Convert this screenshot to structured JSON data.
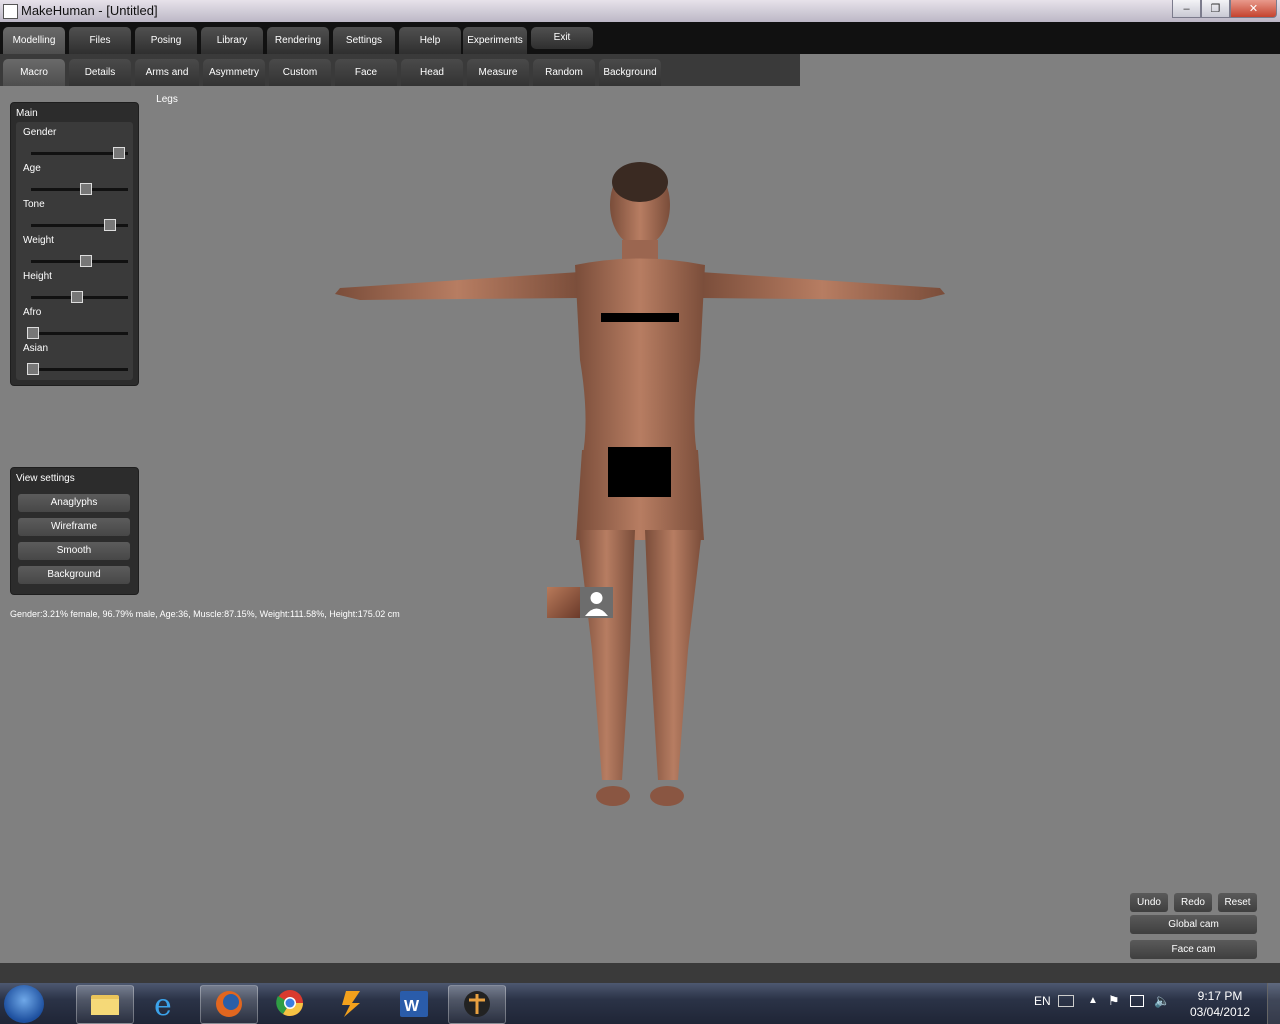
{
  "window": {
    "title": "MakeHuman - [Untitled]"
  },
  "main_tabs": [
    "Modelling",
    "Files",
    "Posing",
    "Library",
    "Rendering",
    "Settings",
    "Help",
    "Experiments",
    "Exit"
  ],
  "sub_tabs": [
    "Macro",
    "Details",
    "Arms and Legs",
    "Asymmetry",
    "Custom",
    "Face",
    "Head",
    "Measure",
    "Random",
    "Background"
  ],
  "main_panel": {
    "title": "Main",
    "sliders": [
      {
        "label": "Gender",
        "value": 0.9679
      },
      {
        "label": "Age",
        "value": 0.6
      },
      {
        "label": "Tone",
        "value": 0.87
      },
      {
        "label": "Weight",
        "value": 0.6
      },
      {
        "label": "Height",
        "value": 0.49
      },
      {
        "label": "Afro",
        "value": 0.0
      },
      {
        "label": "Asian",
        "value": 0.0
      }
    ]
  },
  "view_panel": {
    "title": "View settings",
    "buttons": [
      "Anaglyphs",
      "Wireframe",
      "Smooth",
      "Background"
    ]
  },
  "status": "Gender:3.21% female, 96.79% male, Age:36, Muscle:87.15%, Weight:111.58%, Height:175.02 cm",
  "controls": {
    "undo": "Undo",
    "redo": "Redo",
    "reset": "Reset",
    "global_cam": "Global cam",
    "face_cam": "Face cam"
  },
  "tray": {
    "lang": "EN",
    "time": "9:17 PM",
    "date": "03/04/2012"
  }
}
